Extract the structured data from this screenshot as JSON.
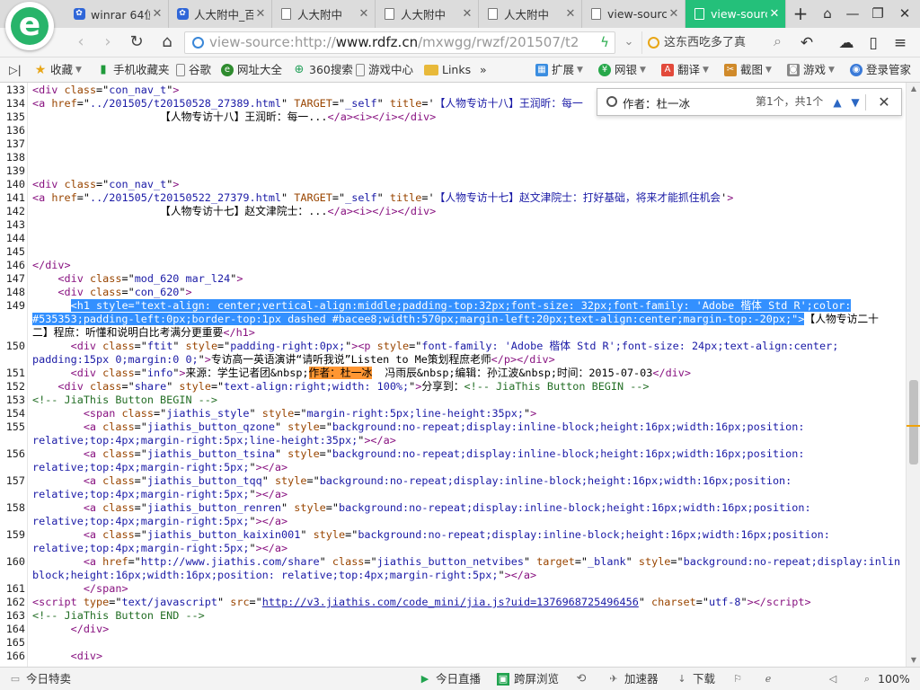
{
  "tabs": [
    {
      "title": "winrar 64位",
      "icon": "baidu-paw-icon"
    },
    {
      "title": "人大附中_百",
      "icon": "baidu-paw-icon"
    },
    {
      "title": "人大附中",
      "icon": "page-icon"
    },
    {
      "title": "人大附中",
      "icon": "page-icon"
    },
    {
      "title": "人大附中",
      "icon": "page-icon"
    },
    {
      "title": "view-sourc",
      "icon": "page-icon"
    },
    {
      "title": "view-sourc",
      "icon": "page-icon",
      "active": true
    }
  ],
  "address": {
    "scheme": "view-source:http://",
    "domain": "www.rdfz.cn",
    "path": "/mxwgg/rwzf/201507/t201"
  },
  "search": {
    "text": "这东西吃多了真"
  },
  "bookmarks": [
    {
      "label": "收藏",
      "icon": "star-icon",
      "caret": true
    },
    {
      "label": "手机收藏夹",
      "icon": "phone-icon"
    },
    {
      "label": "谷歌",
      "icon": "page-icon"
    },
    {
      "label": "网址大全",
      "icon": "web-directory-icon"
    },
    {
      "label": "360搜索",
      "icon": "search-360-icon"
    },
    {
      "label": "游戏中心",
      "icon": "page-icon"
    },
    {
      "label": "Links",
      "icon": "folder-icon"
    }
  ],
  "bookmarks_more": "»",
  "toolbar_right": [
    {
      "label": "扩展",
      "icon": "extension-icon"
    },
    {
      "label": "网银",
      "icon": "bank-icon"
    },
    {
      "label": "翻译",
      "icon": "translate-icon"
    },
    {
      "label": "截图",
      "icon": "screenshot-icon"
    },
    {
      "label": "游戏",
      "icon": "game-icon"
    },
    {
      "label": "登录管家",
      "icon": "login-manager-icon"
    }
  ],
  "find": {
    "query": "作者：杜一冰",
    "count": "第1个，共1个"
  },
  "source_lines": [
    {
      "n": "133",
      "h": "<span class='t'>&lt;div</span> <span class='a'>class</span>=\"<span class='v'>con_nav_t</span>\"<span class='t'>&gt;</span>"
    },
    {
      "n": "134",
      "h": "<span class='t'>&lt;a</span> <span class='a'>href</span>=\"<span class='v'>../201505/t20150528_27389.html</span>\" <span class='a'>TARGET</span>=\"<span class='v'>_self</span>\" <span class='a'>title</span>='<span class='v'>【人物专访十八】王润昕：每一</span>"
    },
    {
      "n": "135",
      "h": "                    【人物专访十八】王润昕：每一...<span class='t'>&lt;/a&gt;&lt;i&gt;&lt;/i&gt;&lt;/div&gt;</span>"
    },
    {
      "n": "136",
      "h": ""
    },
    {
      "n": "137",
      "h": ""
    },
    {
      "n": "138",
      "h": ""
    },
    {
      "n": "139",
      "h": ""
    },
    {
      "n": "140",
      "h": "<span class='t'>&lt;div</span> <span class='a'>class</span>=\"<span class='v'>con_nav_t</span>\"<span class='t'>&gt;</span>"
    },
    {
      "n": "141",
      "h": "<span class='t'>&lt;a</span> <span class='a'>href</span>=\"<span class='v'>../201505/t20150522_27379.html</span>\" <span class='a'>TARGET</span>=\"<span class='v'>_self</span>\" <span class='a'>title</span>='<span class='v'>【人物专访十七】赵文津院士：打好基础，将来才能抓住机会</span>'<span class='t'>&gt;</span>"
    },
    {
      "n": "142",
      "h": "                    【人物专访十七】赵文津院士：...<span class='t'>&lt;/a&gt;&lt;i&gt;&lt;/i&gt;&lt;/div&gt;</span>"
    },
    {
      "n": "143",
      "h": ""
    },
    {
      "n": "144",
      "h": ""
    },
    {
      "n": "145",
      "h": ""
    },
    {
      "n": "146",
      "h": "<span class='t'>&lt;/div&gt;</span>"
    },
    {
      "n": "147",
      "h": "    <span class='t'>&lt;div</span> <span class='a'>class</span>=\"<span class='v'>mod_620 mar_l24</span>\"<span class='t'>&gt;</span>"
    },
    {
      "n": "148",
      "h": "    <span class='t'>&lt;div</span> <span class='a'>class</span>=\"<span class='v'>con_620</span>\"<span class='t'>&gt;</span>"
    },
    {
      "n": "149",
      "h": "      <span class='sel'>&lt;h1 style=\"text-align: center;vertical-align:middle;padding-top:32px;font-size: 32px;font-family: 'Adobe 楷体 Std R';color:</span>"
    },
    {
      "n": "",
      "h": "<span class='sel'>#535353;padding-left:0px;border-top:1px dashed #bacee8;width:570px;margin-left:20px;text-align:center;margin-top:-20px;\"&gt;</span>【人物专访二十"
    },
    {
      "n": "",
      "h": "二】程庶：听懂和说明白比考满分更重要<span class='t'>&lt;/h1&gt;</span>"
    },
    {
      "n": "150",
      "h": "      <span class='t'>&lt;div</span> <span class='a'>class</span>=\"<span class='v'>ftit</span>\" <span class='a'>style</span>=\"<span class='v'>padding-right:0px;</span>\"<span class='t'>&gt;&lt;p</span> <span class='a'>style</span>=\"<span class='v'>font-family: 'Adobe 楷体 Std R';font-size: 24px;text-align:center;</span>"
    },
    {
      "n": "",
      "h": "<span class='v'>padding:15px 0;margin:0 0;</span>\"<span class='t'>&gt;</span>专访高一英语演讲“请听我说”Listen to Me策划程庶老师<span class='t'>&lt;/p&gt;&lt;/div&gt;</span>"
    },
    {
      "n": "151",
      "h": "      <span class='t'>&lt;div</span> <span class='a'>class</span>=\"<span class='v'>info</span>\"<span class='t'>&gt;</span>来源：学生记者团&amp;nbsp;<span class='hit'>作者：杜一冰</span>  冯雨辰&amp;nbsp;编辑：孙江波&amp;nbsp;时间：2015-07-03<span class='t'>&lt;/div&gt;</span>"
    },
    {
      "n": "152",
      "h": "    <span class='t'>&lt;div</span> <span class='a'>class</span>=\"<span class='v'>share</span>\" <span class='a'>style</span>=\"<span class='v'>text-align:right;width: 100%;</span>\"<span class='t'>&gt;</span>分享到：<span class='c'>&lt;!-- JiaThis Button BEGIN --&gt;</span>"
    },
    {
      "n": "153",
      "h": "<span class='c'>&lt;!-- JiaThis Button BEGIN --&gt;</span>"
    },
    {
      "n": "154",
      "h": "        <span class='t'>&lt;span</span> <span class='a'>class</span>=\"<span class='v'>jiathis_style</span>\" <span class='a'>style</span>=\"<span class='v'>margin-right:5px;line-height:35px;</span>\"<span class='t'>&gt;</span>"
    },
    {
      "n": "155",
      "h": "        <span class='t'>&lt;a</span> <span class='a'>class</span>=\"<span class='v'>jiathis_button_qzone</span>\" <span class='a'>style</span>=\"<span class='v'>background:no-repeat;display:inline-block;height:16px;width:16px;position:</span>"
    },
    {
      "n": "",
      "h": "<span class='v'>relative;top:4px;margin-right:5px;line-height:35px;</span>\"<span class='t'>&gt;&lt;/a&gt;</span>"
    },
    {
      "n": "156",
      "h": "        <span class='t'>&lt;a</span> <span class='a'>class</span>=\"<span class='v'>jiathis_button_tsina</span>\" <span class='a'>style</span>=\"<span class='v'>background:no-repeat;display:inline-block;height:16px;width:16px;position:</span>"
    },
    {
      "n": "",
      "h": "<span class='v'>relative;top:4px;margin-right:5px;</span>\"<span class='t'>&gt;&lt;/a&gt;</span>"
    },
    {
      "n": "157",
      "h": "        <span class='t'>&lt;a</span> <span class='a'>class</span>=\"<span class='v'>jiathis_button_tqq</span>\" <span class='a'>style</span>=\"<span class='v'>background:no-repeat;display:inline-block;height:16px;width:16px;position:</span>"
    },
    {
      "n": "",
      "h": "<span class='v'>relative;top:4px;margin-right:5px;</span>\"<span class='t'>&gt;&lt;/a&gt;</span>"
    },
    {
      "n": "158",
      "h": "        <span class='t'>&lt;a</span> <span class='a'>class</span>=\"<span class='v'>jiathis_button_renren</span>\" <span class='a'>style</span>=\"<span class='v'>background:no-repeat;display:inline-block;height:16px;width:16px;position:</span>"
    },
    {
      "n": "",
      "h": "<span class='v'>relative;top:4px;margin-right:5px;</span>\"<span class='t'>&gt;&lt;/a&gt;</span>"
    },
    {
      "n": "159",
      "h": "        <span class='t'>&lt;a</span> <span class='a'>class</span>=\"<span class='v'>jiathis_button_kaixin001</span>\" <span class='a'>style</span>=\"<span class='v'>background:no-repeat;display:inline-block;height:16px;width:16px;position:</span>"
    },
    {
      "n": "",
      "h": "<span class='v'>relative;top:4px;margin-right:5px;</span>\"<span class='t'>&gt;&lt;/a&gt;</span>"
    },
    {
      "n": "160",
      "h": "        <span class='t'>&lt;a</span> <span class='a'>href</span>=\"<span class='v'>http://www.jiathis.com/share</span>\" <span class='a'>class</span>=\"<span class='v'>jiathis_button_netvibes</span>\" <span class='a'>target</span>=\"<span class='v'>_blank</span>\" <span class='a'>style</span>=\"<span class='v'>background:no-repeat;display:inline-</span>"
    },
    {
      "n": "",
      "h": "<span class='v'>block;height:16px;width:16px;position: relative;top:4px;margin-right:5px;</span>\"<span class='t'>&gt;&lt;/a&gt;</span>"
    },
    {
      "n": "161",
      "h": "        <span class='t'>&lt;/span&gt;</span>"
    },
    {
      "n": "162",
      "h": "<span class='t'>&lt;script</span> <span class='a'>type</span>=\"<span class='v'>text/javascript</span>\" <span class='a'>src</span>=\"<span class='lk'>http://v3.jiathis.com/code_mini/jia.js?uid=1376968725496456</span>\" <span class='a'>charset</span>=\"<span class='v'>utf-8</span>\"<span class='t'>&gt;&lt;/script&gt;</span>"
    },
    {
      "n": "163",
      "h": "<span class='c'>&lt;!-- JiaThis Button END --&gt;</span>"
    },
    {
      "n": "164",
      "h": "      <span class='t'>&lt;/div&gt;</span>"
    },
    {
      "n": "165",
      "h": ""
    },
    {
      "n": "166",
      "h": "      <span class='t'>&lt;div&gt;</span>"
    }
  ],
  "scrollbar": {
    "thumb_top_fraction": 0.51,
    "thumb_size_fraction": 0.15,
    "match_marker_fraction": 0.59
  },
  "status": [
    {
      "label": "今日特卖",
      "icon": "sale-icon"
    },
    {
      "label": "今日直播",
      "icon": "live-icon"
    },
    {
      "label": "跨屏浏览",
      "icon": "cross-screen-icon"
    },
    {
      "label": "",
      "icon": "history-icon"
    },
    {
      "label": "加速器",
      "icon": "accelerator-icon"
    },
    {
      "label": "下载",
      "icon": "download-icon"
    },
    {
      "label": "",
      "icon": "flag-icon"
    },
    {
      "label": "",
      "icon": "ie-icon"
    },
    {
      "label": "",
      "icon": "volume-icon"
    },
    {
      "label": "100%",
      "icon": "zoom-icon"
    }
  ],
  "colors": {
    "accent": "#24c07a",
    "selection": "#3390ff",
    "find_hit": "#ff9632"
  }
}
